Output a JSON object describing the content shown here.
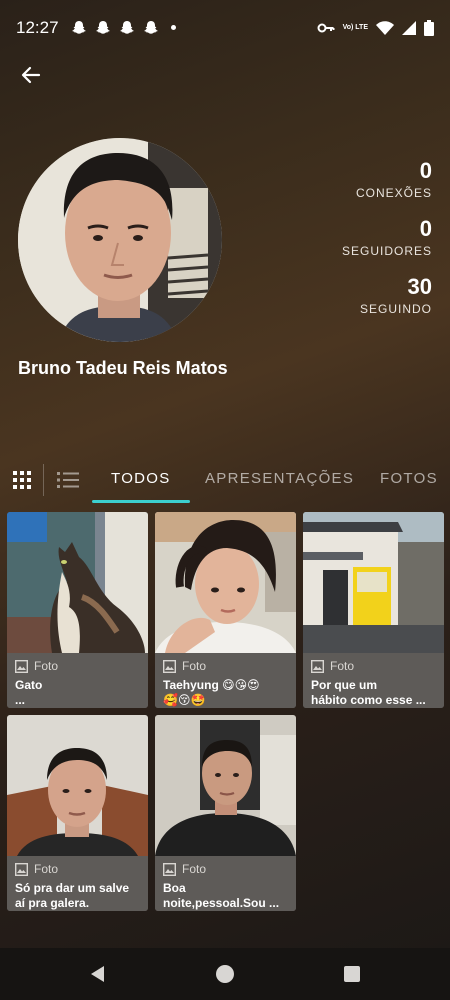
{
  "status_bar": {
    "time": "12:27",
    "network": "Vo) LTE"
  },
  "header": {
    "back_icon": "arrow-left-icon"
  },
  "profile": {
    "name": "Bruno Tadeu Reis Matos",
    "stats": [
      {
        "value": "0",
        "label": "CONEXÕES"
      },
      {
        "value": "0",
        "label": "SEGUIDORES"
      },
      {
        "value": "30",
        "label": "SEGUINDO"
      }
    ]
  },
  "tabs": {
    "items": [
      "TODOS",
      "APRESENTAÇÕES",
      "FOTOS"
    ],
    "active": "TODOS"
  },
  "posts": [
    {
      "type": "Foto",
      "title": "Gato\n..."
    },
    {
      "type": "Foto",
      "title": "Taehyung 😋😘😍\n🥰😚🤩"
    },
    {
      "type": "Foto",
      "title": "Por que um\nhábito como esse ..."
    },
    {
      "type": "Foto",
      "title": "Só pra dar um salve\naí pra galera."
    },
    {
      "type": "Foto",
      "title": "Boa\nnoite,pessoal.Sou ..."
    }
  ],
  "colors": {
    "accent": "#3ccfcf",
    "card_info_bg": "#5e5b58",
    "nav_bar_bg": "#161412"
  }
}
